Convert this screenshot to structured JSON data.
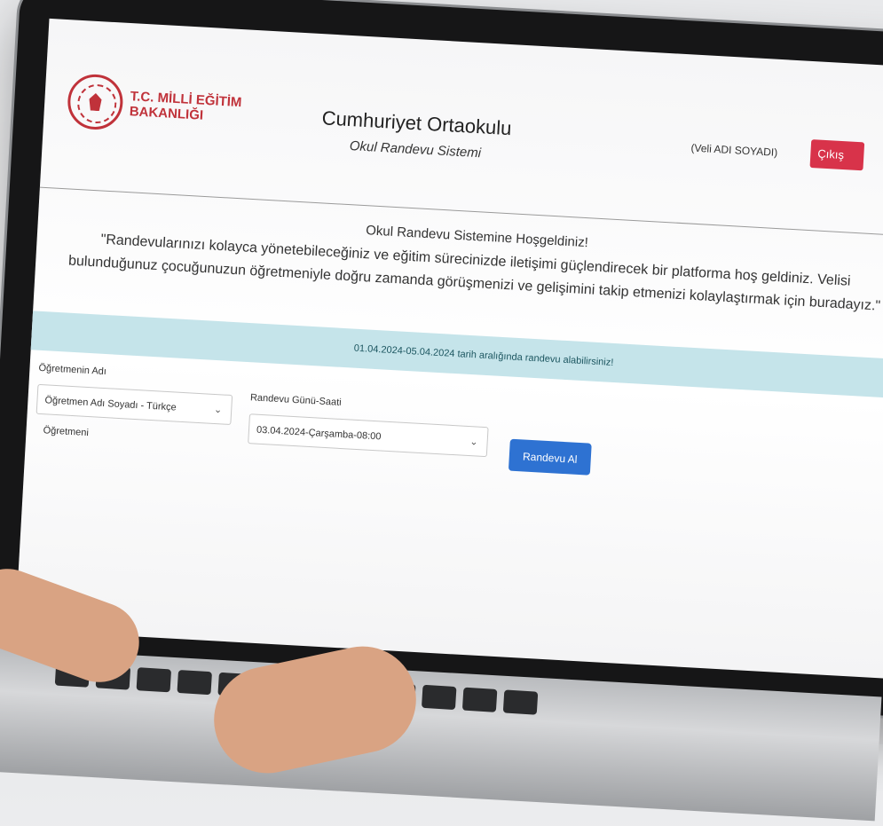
{
  "logo": {
    "line1": "T.C. MİLLİ EĞİTİM",
    "line2": "BAKANLIĞI"
  },
  "header": {
    "school_name": "Cumhuriyet Ortaokulu",
    "system_name": "Okul Randevu Sistemi",
    "user_label": "(Veli ADI SOYADI)",
    "logout_label": "Çıkış"
  },
  "welcome": {
    "title": "Okul Randevu Sistemine Hoşgeldiniz!",
    "text": "\"Randevularınızı kolayca yönetebileceğiniz ve eğitim sürecinizde iletişimi güçlendirecek bir platforma hoş geldiniz. Velisi bulunduğunuz çocuğunuzun öğretmeniyle doğru zamanda görüşmenizi ve gelişimini takip etmenizi kolaylaştırmak için buradayız.\""
  },
  "info_band": "01.04.2024-05.04.2024 tarih aralığında randevu alabilirsiniz!",
  "form": {
    "teacher_label": "Öğretmenin Adı",
    "teacher_value": "Öğretmen Adı Soyadı - Türkçe Öğretmeni",
    "date_label": "Randevu Günü-Saati",
    "date_value": "03.04.2024-Çarşamba-08:00",
    "submit_label": "Randevu Al"
  },
  "colors": {
    "brand_red": "#c0323a",
    "logout_red": "#d8334a",
    "button_blue": "#2e72d2",
    "info_bg": "#c5e4ea"
  }
}
